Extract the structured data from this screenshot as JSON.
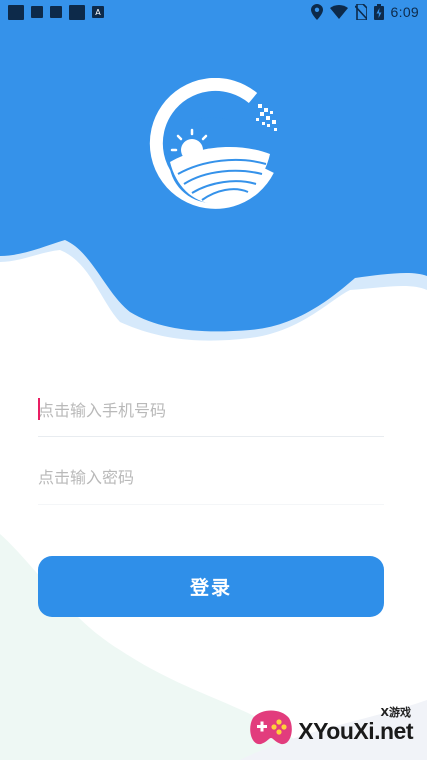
{
  "status_bar": {
    "time": "6:09",
    "left_icons": [
      "app-icon",
      "image-icon",
      "square-icon",
      "app-icon",
      "font-icon"
    ],
    "notif_letter": "A",
    "right_icons": [
      "location-icon",
      "wifi-icon",
      "no-sim-icon",
      "battery-icon"
    ]
  },
  "login": {
    "phone_placeholder": "点击输入手机号码",
    "password_placeholder": "点击输入密码",
    "button_label": "登录"
  },
  "watermark": {
    "small_text": "X游戏",
    "site_text": "XYouXi.net"
  },
  "colors": {
    "primary": "#2f8fe9",
    "header": "#3592ea",
    "cloud_shadow": "#cfe6fa",
    "caret": "#e91e63",
    "bottom_wave": "#eef8f4"
  }
}
